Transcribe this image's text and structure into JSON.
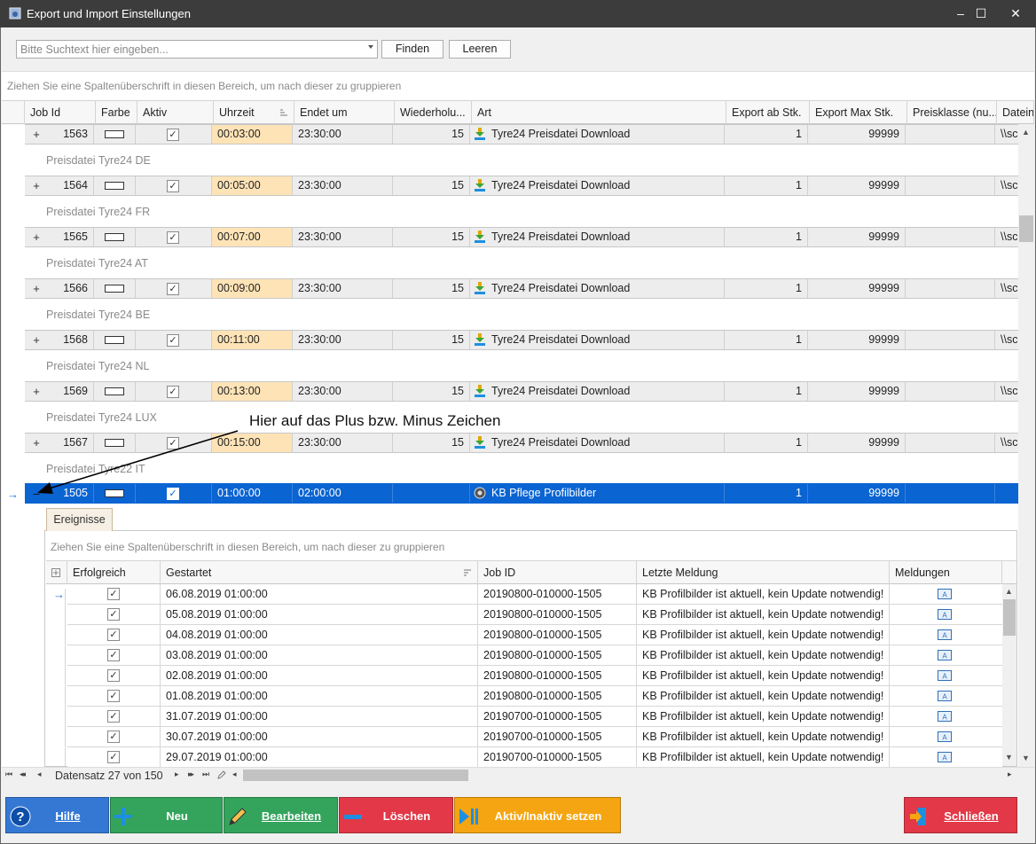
{
  "window": {
    "title": "Export und Import Einstellungen",
    "minimize": "–",
    "maximize": "☐",
    "close": "✕"
  },
  "search": {
    "placeholder": "Bitte Suchtext hier eingeben...",
    "find_label": "Finden",
    "clear_label": "Leeren"
  },
  "grid": {
    "group_hint": "Ziehen Sie eine Spaltenüberschrift in diesen Bereich, um nach dieser zu gruppieren",
    "columns": [
      "Job Id",
      "Farbe",
      "Aktiv",
      "Uhrzeit",
      "Endet um",
      "Wiederholu...",
      "Art",
      "Export ab Stk.",
      "Export Max Stk.",
      "Preisklasse (nu...",
      "Datein"
    ],
    "rows": [
      {
        "expander": "+",
        "job_id": "1563",
        "time": "00:03:00",
        "end": "23:30:00",
        "repeat": "15",
        "art": "Tyre24 Preisdatei Download",
        "export_from": "1",
        "export_max": "99999",
        "path": "\\\\sc",
        "description": "Preisdatei Tyre24 DE"
      },
      {
        "expander": "+",
        "job_id": "1564",
        "time": "00:05:00",
        "end": "23:30:00",
        "repeat": "15",
        "art": "Tyre24 Preisdatei Download",
        "export_from": "1",
        "export_max": "99999",
        "path": "\\\\sc",
        "description": "Preisdatei Tyre24 FR"
      },
      {
        "expander": "+",
        "job_id": "1565",
        "time": "00:07:00",
        "end": "23:30:00",
        "repeat": "15",
        "art": "Tyre24 Preisdatei Download",
        "export_from": "1",
        "export_max": "99999",
        "path": "\\\\sc",
        "description": "Preisdatei Tyre24 AT"
      },
      {
        "expander": "+",
        "job_id": "1566",
        "time": "00:09:00",
        "end": "23:30:00",
        "repeat": "15",
        "art": "Tyre24 Preisdatei Download",
        "export_from": "1",
        "export_max": "99999",
        "path": "\\\\sc",
        "description": "Preisdatei Tyre24 BE"
      },
      {
        "expander": "+",
        "job_id": "1568",
        "time": "00:11:00",
        "end": "23:30:00",
        "repeat": "15",
        "art": "Tyre24 Preisdatei Download",
        "export_from": "1",
        "export_max": "99999",
        "path": "\\\\sc",
        "description": "Preisdatei Tyre24 NL"
      },
      {
        "expander": "+",
        "job_id": "1569",
        "time": "00:13:00",
        "end": "23:30:00",
        "repeat": "15",
        "art": "Tyre24 Preisdatei Download",
        "export_from": "1",
        "export_max": "99999",
        "path": "\\\\sc",
        "description": "Preisdatei Tyre24 LUX"
      },
      {
        "expander": "+",
        "job_id": "1567",
        "time": "00:15:00",
        "end": "23:30:00",
        "repeat": "15",
        "art": "Tyre24 Preisdatei Download",
        "export_from": "1",
        "export_max": "99999",
        "path": "\\\\sc",
        "description": "Preisdatei Tyre22 IT"
      }
    ],
    "selected_row": {
      "expander": "–",
      "job_id": "1505",
      "time": "01:00:00",
      "end": "02:00:00",
      "repeat": "",
      "art": "KB Pflege Profilbilder",
      "export_from": "1",
      "export_max": "99999"
    },
    "row_indicator": "→",
    "checkmark": "✓"
  },
  "annotation": "Hier auf das Plus bzw. Minus Zeichen",
  "detail": {
    "tab_label": "Ereignisse",
    "group_hint": "Ziehen Sie eine Spaltenüberschrift in diesen Bereich, um nach dieser zu gruppieren",
    "columns": [
      "Erfolgreich",
      "Gestartet",
      "Job ID",
      "Letzte Meldung",
      "Meldungen"
    ],
    "rows": [
      {
        "started": "06.08.2019 01:00:00",
        "job_id": "20190800-010000-1505",
        "message": "KB Profilbilder ist aktuell, kein Update notwendig!"
      },
      {
        "started": "05.08.2019 01:00:00",
        "job_id": "20190800-010000-1505",
        "message": "KB Profilbilder ist aktuell, kein Update notwendig!"
      },
      {
        "started": "04.08.2019 01:00:00",
        "job_id": "20190800-010000-1505",
        "message": "KB Profilbilder ist aktuell, kein Update notwendig!"
      },
      {
        "started": "03.08.2019 01:00:00",
        "job_id": "20190800-010000-1505",
        "message": "KB Profilbilder ist aktuell, kein Update notwendig!"
      },
      {
        "started": "02.08.2019 01:00:00",
        "job_id": "20190800-010000-1505",
        "message": "KB Profilbilder ist aktuell, kein Update notwendig!"
      },
      {
        "started": "01.08.2019 01:00:00",
        "job_id": "20190800-010000-1505",
        "message": "KB Profilbilder ist aktuell, kein Update notwendig!"
      },
      {
        "started": "31.07.2019 01:00:00",
        "job_id": "20190700-010000-1505",
        "message": "KB Profilbilder ist aktuell, kein Update notwendig!"
      },
      {
        "started": "30.07.2019 01:00:00",
        "job_id": "20190700-010000-1505",
        "message": "KB Profilbilder ist aktuell, kein Update notwendig!"
      },
      {
        "started": "29.07.2019 01:00:00",
        "job_id": "20190700-010000-1505",
        "message": "KB Profilbilder ist aktuell, kein Update notwendig!"
      }
    ]
  },
  "navigator": {
    "record_text": "Datensatz 27 von 150",
    "first": "⏮",
    "prev_page": "◂◂",
    "prev": "◂",
    "next": "▸",
    "next_page": "▸▸",
    "last": "⏭"
  },
  "buttons": {
    "help": "Hilfe",
    "new": "Neu",
    "edit": "Bearbeiten",
    "delete": "Löschen",
    "toggle_active": "Aktiv/Inaktiv setzen",
    "close": "Schließen"
  },
  "colors": {
    "help": "#3478d4",
    "new": "#34a35c",
    "edit": "#34a35c",
    "delete": "#e23847",
    "toggle_active": "#f5a511",
    "close": "#e23847",
    "selection": "#0a64d2",
    "time_highlight": "#fde3b6"
  }
}
